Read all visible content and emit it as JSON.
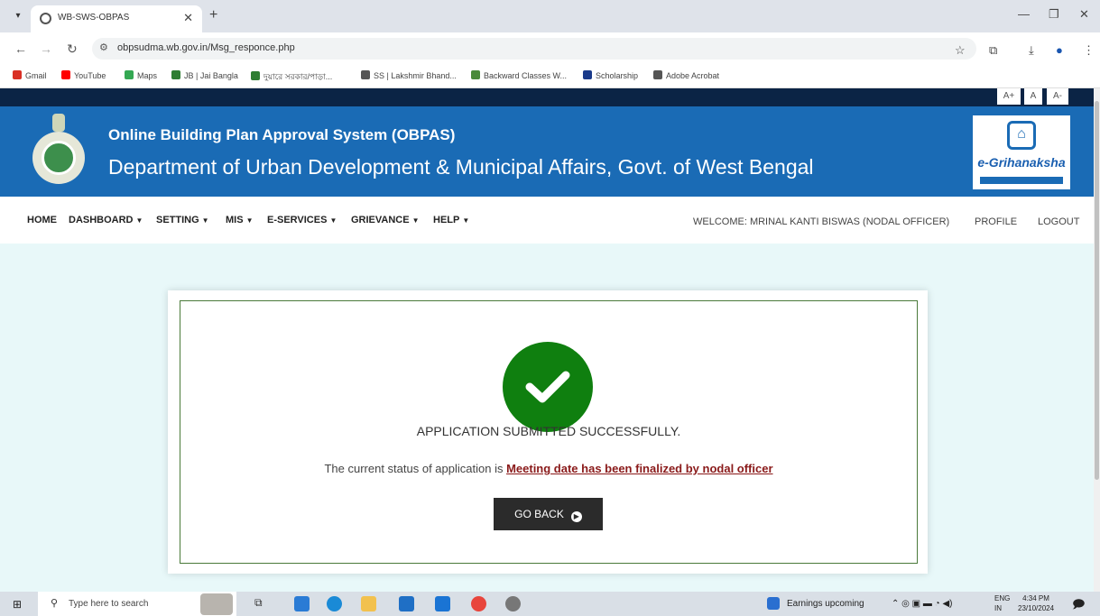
{
  "browser": {
    "tab_title": "WB-SWS-OBPAS",
    "url": "obpsudma.wb.gov.in/Msg_responce.php",
    "bookmarks": [
      {
        "label": "Gmail",
        "color": "#d93025"
      },
      {
        "label": "YouTube",
        "color": "#ff0000"
      },
      {
        "label": "Maps",
        "color": "#34a853"
      },
      {
        "label": "JB | Jai Bangla",
        "color": "#2e7d32"
      },
      {
        "label": "দুয়ারে সরকার/পাড়া...",
        "color": "#2e7d32"
      },
      {
        "label": "SS | Lakshmir Bhand...",
        "color": "#555555"
      },
      {
        "label": "Backward Classes W...",
        "color": "#4a8a3a"
      },
      {
        "label": "Scholarship",
        "color": "#1a3a8a"
      },
      {
        "label": "Adobe Acrobat",
        "color": "#555555"
      }
    ]
  },
  "page": {
    "font_controls": {
      "plus": "A+",
      "normal": "A",
      "minus": "A-"
    },
    "banner": {
      "title": "Online Building Plan Approval System (OBPAS)",
      "department": "Department of Urban Development & Municipal Affairs, Govt. of West Bengal",
      "logo_text": "e-Grihanaksha"
    },
    "nav": {
      "items": [
        "HOME",
        "DASHBOARD",
        "SETTING",
        "MIS",
        "E-SERVICES",
        "GRIEVANCE",
        "HELP"
      ],
      "welcome": "WELCOME: MRINAL KANTI BISWAS (NODAL OFFICER)",
      "profile": "PROFILE",
      "logout": "LOGOUT"
    },
    "message": {
      "title": "APPLICATION SUBMITTED SUCCESSFULLY.",
      "status_prefix": "The current status of application is ",
      "status_value": "Meeting date has been finalized by nodal officer",
      "button": "GO BACK"
    }
  },
  "taskbar": {
    "search_placeholder": "Type here to search",
    "notification": "Earnings upcoming",
    "lang_top": "ENG",
    "lang_bottom": "IN",
    "time": "4:34 PM",
    "date": "23/10/2024"
  },
  "colors": {
    "banner": "#1a6bb5",
    "top_strip": "#0b2445",
    "success": "#0f7f0f",
    "status_link": "#8a1a1a",
    "content_bg": "#e8f8f9"
  }
}
